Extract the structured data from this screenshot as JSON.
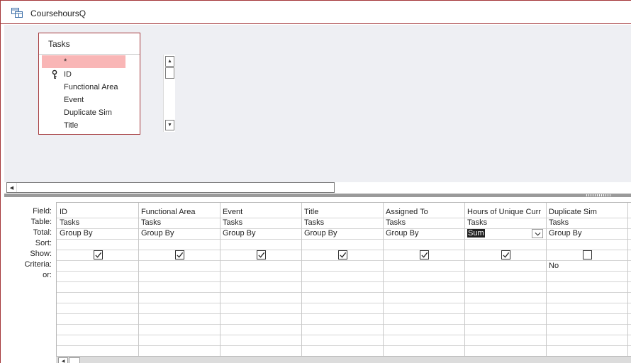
{
  "window": {
    "title": "CoursehoursQ"
  },
  "table_box": {
    "title": "Tasks",
    "fields": [
      {
        "label": "*",
        "selected": true,
        "primary_key": false
      },
      {
        "label": "ID",
        "selected": false,
        "primary_key": true
      },
      {
        "label": "Functional Area",
        "selected": false,
        "primary_key": false
      },
      {
        "label": "Event",
        "selected": false,
        "primary_key": false
      },
      {
        "label": "Duplicate Sim",
        "selected": false,
        "primary_key": false
      },
      {
        "label": "Title",
        "selected": false,
        "primary_key": false
      }
    ]
  },
  "grid": {
    "row_labels": {
      "field": "Field:",
      "table": "Table:",
      "total": "Total:",
      "sort": "Sort:",
      "show": "Show:",
      "criteria": "Criteria:",
      "or": "or:"
    },
    "columns": [
      {
        "field": "ID",
        "table": "Tasks",
        "total": "Group By",
        "sort": "",
        "show": true,
        "criteria": "",
        "or": ""
      },
      {
        "field": "Functional Area",
        "table": "Tasks",
        "total": "Group By",
        "sort": "",
        "show": true,
        "criteria": "",
        "or": ""
      },
      {
        "field": "Event",
        "table": "Tasks",
        "total": "Group By",
        "sort": "",
        "show": true,
        "criteria": "",
        "or": ""
      },
      {
        "field": "Title",
        "table": "Tasks",
        "total": "Group By",
        "sort": "",
        "show": true,
        "criteria": "",
        "or": ""
      },
      {
        "field": "Assigned To",
        "table": "Tasks",
        "total": "Group By",
        "sort": "",
        "show": true,
        "criteria": "",
        "or": ""
      },
      {
        "field": "Hours of Unique Curr",
        "table": "Tasks",
        "total": "Sum",
        "sort": "",
        "show": true,
        "criteria": "",
        "or": "",
        "total_selected": true
      },
      {
        "field": "Duplicate Sim",
        "table": "Tasks",
        "total": "Group By",
        "sort": "",
        "show": false,
        "criteria": "No",
        "or": ""
      }
    ]
  },
  "icons": {
    "query": "query-icon",
    "key": "primary-key-icon",
    "check": "checkmark-icon",
    "dropdown": "chevron-down-icon",
    "scroll_up": "arrow-up-icon",
    "scroll_down": "arrow-down-icon",
    "scroll_left": "arrow-left-icon"
  },
  "colors": {
    "accent": "#a4373a",
    "selected_row": "#f9b6b6",
    "upper_pane": "#eeeff3",
    "splitter": "#9a9a9a"
  }
}
